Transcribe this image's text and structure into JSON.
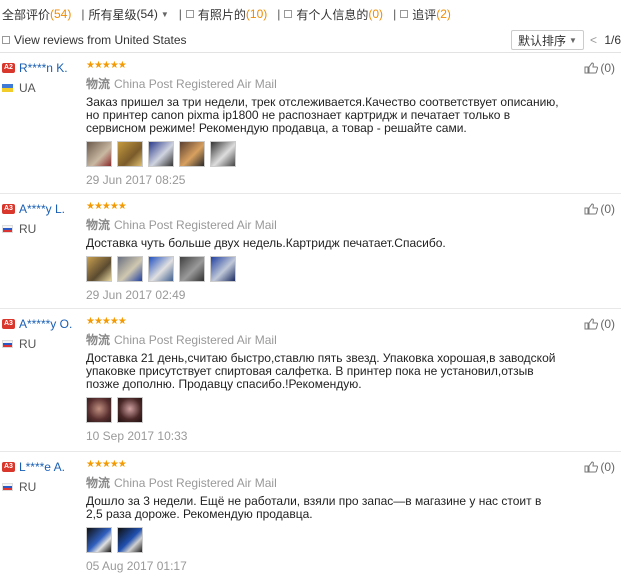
{
  "filters": {
    "all_label": "全部评价",
    "all_count": "(54)",
    "stars_label": "所有星级",
    "stars_count": "(54)",
    "photos_label": "有照片的",
    "photos_count": "(10)",
    "personal_label": "有个人信息的",
    "personal_count": "(0)",
    "followup_label": "追评",
    "followup_count": "(2)"
  },
  "subbar": {
    "us_label": "View reviews from United States",
    "sort_label": "默认排序",
    "pager": "1/6"
  },
  "reviews": [
    {
      "level": "A2",
      "name": "R****n K.",
      "country": "UA",
      "ship_label": "物流",
      "shipping": "China Post Registered Air Mail",
      "text": "Заказ пришел за три недели, трек отслеживается.Качество соответствует описанию, но принтер canon pixma ip1800 не распознает картридж и печатает только в сервисном режиме! Рекомендую продавца, а товар - решайте сами.",
      "date": "29 Jun 2017 08:25",
      "useful": "(0)"
    },
    {
      "level": "A3",
      "name": "A****y L.",
      "country": "RU",
      "ship_label": "物流",
      "shipping": "China Post Registered Air Mail",
      "text": "Доставка чуть больше двух недель.Картридж печатает.Спасибо.",
      "date": "29 Jun 2017 02:49",
      "useful": "(0)"
    },
    {
      "level": "A3",
      "name": "A*****y O.",
      "country": "RU",
      "ship_label": "物流",
      "shipping": "China Post Registered Air Mail",
      "text": "Доставка 21 день,считаю быстро,ставлю пять звезд. Упаковка хорошая,в заводской упаковке присутствует спиртовая салфетка. В принтер пока не установил,отзыв позже дополню. Продавцу спасибо.!Рекомендую.",
      "date": "10 Sep 2017 10:33",
      "useful": "(0)"
    },
    {
      "level": "A3",
      "name": "L****e A.",
      "country": "RU",
      "ship_label": "物流",
      "shipping": "China Post Registered Air Mail",
      "text": "Дошло за 3 недели. Ещё не работали, взяли про запас—в магазине у нас стоит в 2,5 раза дороже. Рекомендую продавца.",
      "date": "05 Aug 2017 01:17",
      "useful": "(0)"
    }
  ],
  "colors": {
    "accent_count": "#f08c00",
    "name_link": "#1a5fb4",
    "stars": "#f59b00",
    "level_badge": "#d9362c"
  }
}
